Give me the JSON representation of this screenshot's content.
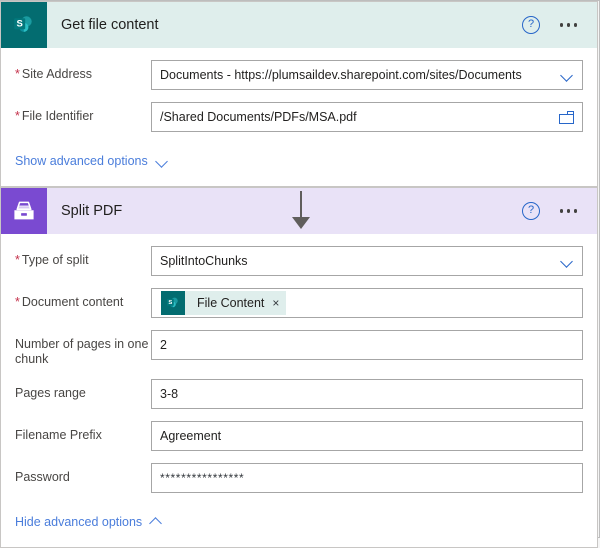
{
  "colors": {
    "sharepoint_teal": "#036c70",
    "sharepoint_header": "#dfeeec",
    "plumsail_purple": "#7a4ad1",
    "plumsail_header": "#e9e2f7",
    "link_blue": "#4a7ddb",
    "icon_blue": "#2766c9",
    "required_red": "#c4314b",
    "page_background": "#f5f5f5"
  },
  "cards": [
    {
      "id": "get-file-content",
      "title": "Get file content",
      "icon": "sharepoint-icon",
      "help_icon": "help-icon",
      "help_label": "?",
      "menu_icon": "ellipsis-icon",
      "fields": [
        {
          "name": "site-address",
          "label": "Site Address",
          "required": true,
          "value": "Documents - https://plumsaildev.sharepoint.com/sites/Documents",
          "trailing_icon": "chevron-down-icon"
        },
        {
          "name": "file-identifier",
          "label": "File Identifier",
          "required": true,
          "value": "/Shared Documents/PDFs/MSA.pdf",
          "trailing_icon": "folder-icon"
        }
      ],
      "advanced_link": {
        "label": "Show advanced options",
        "icon": "chevron-down-icon",
        "state": "collapsed"
      }
    },
    {
      "id": "split-pdf",
      "title": "Split PDF",
      "icon": "file-drawer-icon",
      "help_icon": "help-icon",
      "help_label": "?",
      "menu_icon": "ellipsis-icon",
      "fields": [
        {
          "name": "type-of-split",
          "label": "Type of split",
          "required": true,
          "value": "SplitIntoChunks",
          "trailing_icon": "chevron-down-icon"
        },
        {
          "name": "document-content",
          "label": "Document content",
          "required": true,
          "token": {
            "icon": "sharepoint-icon",
            "label": "File Content",
            "close": "×"
          }
        },
        {
          "name": "number-of-pages-in-one-chunk",
          "label": "Number of pages in one chunk",
          "required": false,
          "value": "2"
        },
        {
          "name": "pages-range",
          "label": "Pages range",
          "required": false,
          "value": "3-8"
        },
        {
          "name": "filename-prefix",
          "label": "Filename Prefix",
          "required": false,
          "value": "Agreement"
        },
        {
          "name": "password",
          "label": "Password",
          "required": false,
          "value": "****************"
        }
      ],
      "advanced_link": {
        "label": "Hide advanced options",
        "icon": "chevron-up-icon",
        "state": "expanded"
      }
    }
  ],
  "connector": {
    "name": "flow-arrow",
    "direction": "down"
  }
}
